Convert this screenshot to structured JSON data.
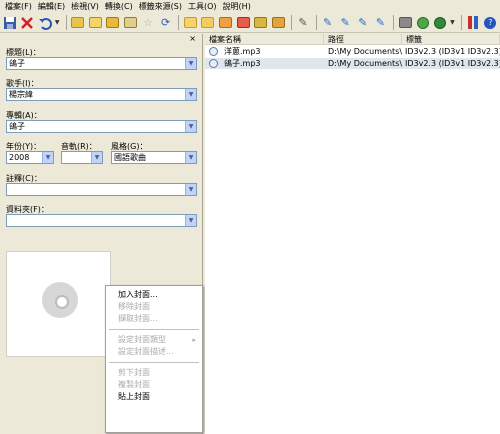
{
  "menu": [
    "檔案(F)",
    "編輯(E)",
    "檢視(V)",
    "轉換(C)",
    "標籤來源(S)",
    "工具(O)",
    "說明(H)"
  ],
  "toolbar_icons": [
    "save-icon",
    "delete-icon",
    "undo-icon",
    "tag-from-filename-icon",
    "filename-from-tag-icon",
    "tag-to-tag-icon",
    "text-file-icon",
    "star-icon",
    "refresh-icon",
    "folder-open-icon",
    "folder-icon",
    "edit-tag-icon",
    "color-tag-icon",
    "playlist-icon",
    "options-icon",
    "web-sources-icon",
    "record-icon",
    "about-icon",
    "help-icon"
  ],
  "panel": {
    "close": "×",
    "title_label": "標題(L)：",
    "title_value": "鴿子",
    "artist_label": "歌手(I)：",
    "artist_value": "楊宗緯",
    "album_label": "專輯(A)：",
    "album_value": "鴿子",
    "year_label": "年份(Y)：",
    "year_value": "2008",
    "track_label": "音軌(R)：",
    "track_value": "",
    "genre_label": "風格(G)：",
    "genre_value": "國語歌曲",
    "comment_label": "註釋(C)：",
    "comment_value": "",
    "directory_label": "資料夾(F)：",
    "directory_value": ""
  },
  "context_menu": {
    "items": [
      {
        "label": "加入封面...",
        "enabled": true
      },
      {
        "label": "移除封面",
        "enabled": false
      },
      {
        "label": "擷取封面...",
        "enabled": false
      },
      {
        "label": "設定封面類型",
        "enabled": false
      },
      {
        "label": "設定封面描述...",
        "enabled": false
      },
      {
        "label": "剪下封面",
        "enabled": false
      },
      {
        "label": "複製封面",
        "enabled": false
      },
      {
        "label": "貼上封面",
        "enabled": true
      }
    ],
    "submenu_arrow": "▸"
  },
  "file_list": {
    "columns": [
      "檔案名稱",
      "路徑",
      "標籤"
    ],
    "rows": [
      {
        "filename": "洋蔥.mp3",
        "path": "D:\\My Documents\\...",
        "tag": "ID3v2.3 (ID3v1 ID3v2.3)"
      },
      {
        "filename": "鴿子.mp3",
        "path": "D:\\My Documents\\...",
        "tag": "ID3v2.3 (ID3v1 ID3v2.3)"
      }
    ]
  },
  "colors": {
    "background": "#ece9d8",
    "list_selected": "#e1e5ee",
    "combo_border": "#7f9db9",
    "disabled_text": "#a9a9a9"
  }
}
